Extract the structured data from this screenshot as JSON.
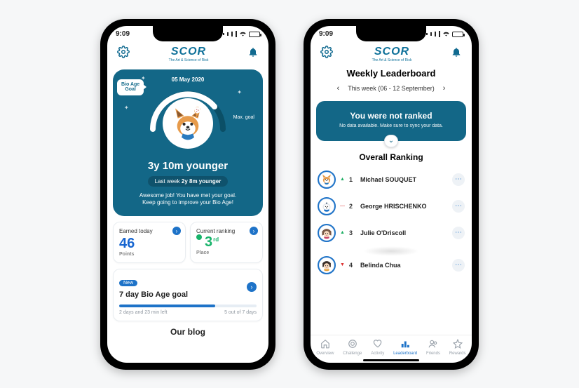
{
  "status": {
    "time": "9:09"
  },
  "brand": {
    "name": "SCOR",
    "tagline": "The Art & Science of Risk"
  },
  "phone1": {
    "hero": {
      "date": "05 May 2020",
      "badge_line1": "Bio Age",
      "badge_line2": "Goal",
      "max_goal": "Max. goal",
      "main": "3y 10m younger",
      "pill_prefix": "Last week",
      "pill_value": "2y 8m younger",
      "msg1": "Awesome job! You have met your goal.",
      "msg2": "Keep going to improve your Bio Age!"
    },
    "stats": {
      "earned_title": "Earned today",
      "earned_value": "46",
      "earned_unit": "Points",
      "rank_title": "Current ranking",
      "rank_value": "3",
      "rank_suffix": "rd",
      "rank_unit": "Place"
    },
    "goal": {
      "new": "New",
      "title": "7 day Bio Age goal",
      "time_left": "2 days and 23 min left",
      "counter": "5 out of 7 days"
    },
    "blog_title": "Our blog"
  },
  "phone2": {
    "weekly_title": "Weekly Leaderboard",
    "week_label": "This week (06 - 12 September)",
    "not_ranked_title": "You were not ranked",
    "not_ranked_msg": "No data available. Make sure to sync your data.",
    "overall_title": "Overall Ranking",
    "rows": [
      {
        "rank": "1",
        "name": "Michael SOUQUET",
        "trend": "up"
      },
      {
        "rank": "2",
        "name": "George HRISCHENKO",
        "trend": "flat"
      },
      {
        "rank": "3",
        "name": "Julie O'Driscoll",
        "trend": "up"
      },
      {
        "rank": "4",
        "name": "Belinda Chua",
        "trend": "down"
      }
    ],
    "tabs": {
      "overview": "Overview",
      "challenge": "Challenge",
      "activity": "Activity",
      "leaderboard": "Leaderboard",
      "friends": "Friends",
      "rewards": "Rewards"
    }
  }
}
